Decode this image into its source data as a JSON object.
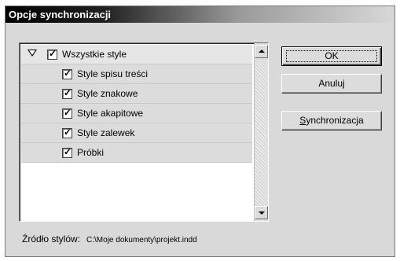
{
  "window": {
    "title": "Opcje synchronizacji"
  },
  "style_list": {
    "items": [
      {
        "label": "Wszystkie style",
        "checked": true,
        "level": 0,
        "expanded": true
      },
      {
        "label": "Style spisu treści",
        "checked": true,
        "level": 1
      },
      {
        "label": "Style znakowe",
        "checked": true,
        "level": 1
      },
      {
        "label": "Style akapitowe",
        "checked": true,
        "level": 1
      },
      {
        "label": "Style zalewek",
        "checked": true,
        "level": 1
      },
      {
        "label": "Próbki",
        "checked": true,
        "level": 1
      }
    ]
  },
  "buttons": {
    "ok": "OK",
    "cancel": "Anuluj",
    "sync_first": "S",
    "sync_rest": "ynchronizacja"
  },
  "footer": {
    "label": "Źródło stylów:",
    "path": "C:\\Moje dokumenty\\projekt.indd"
  }
}
